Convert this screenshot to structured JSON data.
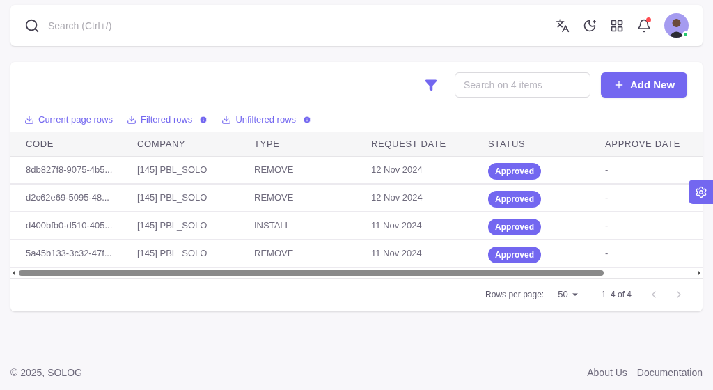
{
  "navbar": {
    "search": {
      "placeholder": "Search (Ctrl+/)"
    },
    "notifications": {
      "unread": true
    },
    "user": {
      "online": true
    }
  },
  "toolbar": {
    "search": {
      "placeholder": "Search on 4 items"
    },
    "add_button": "Add New"
  },
  "exports": [
    {
      "label": "Current page rows",
      "info": false
    },
    {
      "label": "Filtered rows",
      "info": true
    },
    {
      "label": "Unfiltered rows",
      "info": true
    }
  ],
  "table": {
    "columns": [
      "CODE",
      "COMPANY",
      "TYPE",
      "REQUEST DATE",
      "STATUS",
      "APPROVE DATE"
    ],
    "rows": [
      {
        "code": "8db827f8-9075-4b5...",
        "company": "[145] PBL_SOLO",
        "type": "REMOVE",
        "request_date": "12 Nov 2024",
        "status": "Approved",
        "approve_date": "-"
      },
      {
        "code": "d2c62e69-5095-48...",
        "company": "[145] PBL_SOLO",
        "type": "REMOVE",
        "request_date": "12 Nov 2024",
        "status": "Approved",
        "approve_date": "-"
      },
      {
        "code": "d400bfb0-d510-405...",
        "company": "[145] PBL_SOLO",
        "type": "INSTALL",
        "request_date": "11 Nov 2024",
        "status": "Approved",
        "approve_date": "-"
      },
      {
        "code": "5a45b133-3c32-47f...",
        "company": "[145] PBL_SOLO",
        "type": "REMOVE",
        "request_date": "11 Nov 2024",
        "status": "Approved",
        "approve_date": "-"
      }
    ]
  },
  "pagination": {
    "rows_per_page_label": "Rows per page:",
    "rows_per_page": "50",
    "range": "1–4 of 4"
  },
  "footer": {
    "copyright": "© 2025, SOLOG",
    "links": [
      "About Us",
      "Documentation"
    ]
  }
}
